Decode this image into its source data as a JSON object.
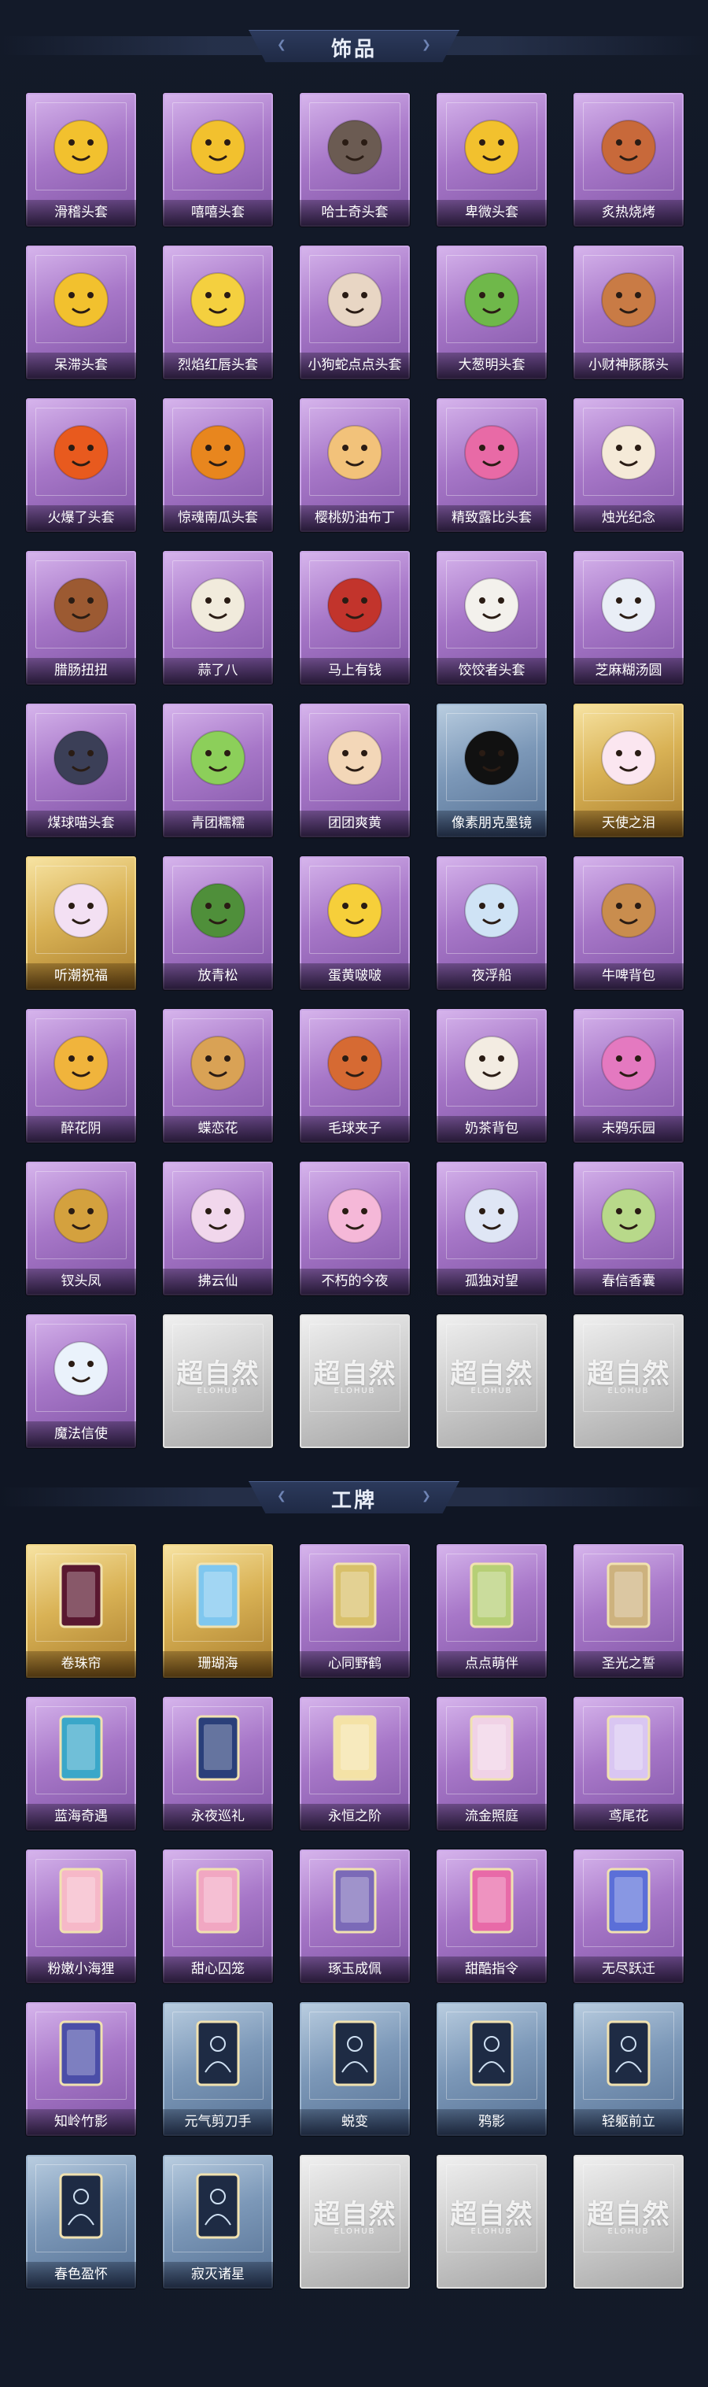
{
  "sections": [
    {
      "title": "饰品",
      "items": [
        {
          "name": "滑稽头套",
          "tier": "purple",
          "icon": "smirk-face-icon",
          "color": "#f2c12e"
        },
        {
          "name": "嘻嘻头套",
          "tier": "purple",
          "icon": "grin-face-icon",
          "color": "#f2c12e"
        },
        {
          "name": "哈士奇头套",
          "tier": "purple",
          "icon": "husky-head-icon",
          "color": "#6b5b52"
        },
        {
          "name": "卑微头套",
          "tier": "purple",
          "icon": "meek-face-icon",
          "color": "#f2c12e"
        },
        {
          "name": "炙热烧烤",
          "tier": "purple",
          "icon": "toast-head-icon",
          "color": "#c8693a"
        },
        {
          "name": "呆滞头套",
          "tier": "purple",
          "icon": "dazed-face-icon",
          "color": "#f2c12e"
        },
        {
          "name": "烈焰红唇头套",
          "tier": "purple",
          "icon": "pikachu-lips-icon",
          "color": "#f4d03f"
        },
        {
          "name": "小狗蛇点点头套",
          "tier": "purple",
          "icon": "puppy-snake-icon",
          "color": "#e8d6c4"
        },
        {
          "name": "大葱明头套",
          "tier": "purple",
          "icon": "scallion-head-icon",
          "color": "#6fb84a"
        },
        {
          "name": "小财神豚豚头",
          "tier": "purple",
          "icon": "fortune-pig-icon",
          "color": "#c97b45"
        },
        {
          "name": "火爆了头套",
          "tier": "purple",
          "icon": "flame-head-icon",
          "color": "#e85a1e"
        },
        {
          "name": "惊魂南瓜头套",
          "tier": "purple",
          "icon": "pumpkin-head-icon",
          "color": "#e8861e"
        },
        {
          "name": "樱桃奶油布丁",
          "tier": "purple",
          "icon": "pudding-head-icon",
          "color": "#f2c27a"
        },
        {
          "name": "精致露比头套",
          "tier": "purple",
          "icon": "pink-monster-icon",
          "color": "#e86aa6"
        },
        {
          "name": "烛光纪念",
          "tier": "purple",
          "icon": "candle-head-icon",
          "color": "#f5ead8"
        },
        {
          "name": "腊肠扭扭",
          "tier": "purple",
          "icon": "dachshund-icon",
          "color": "#9c5a32"
        },
        {
          "name": "蒜了八",
          "tier": "purple",
          "icon": "garlic-head-icon",
          "color": "#f1ebdc"
        },
        {
          "name": "马上有钱",
          "tier": "purple",
          "icon": "red-horse-icon",
          "color": "#c2342c"
        },
        {
          "name": "饺饺者头套",
          "tier": "purple",
          "icon": "dumpling-head-icon",
          "color": "#f3f1ec"
        },
        {
          "name": "芝麻糊汤圆",
          "tier": "purple",
          "icon": "tangyuan-icon",
          "color": "#e9eef6"
        },
        {
          "name": "煤球喵头套",
          "tier": "purple",
          "icon": "black-cat-icon",
          "color": "#3b3f57"
        },
        {
          "name": "青团糯糯",
          "tier": "purple",
          "icon": "qingtuan-icon",
          "color": "#8ccf5a"
        },
        {
          "name": "团团爽黄",
          "tier": "purple",
          "icon": "round-cat-icon",
          "color": "#f3d7b8"
        },
        {
          "name": "像素朋克墨镜",
          "tier": "blue",
          "icon": "pixel-sunglasses-icon",
          "color": "#111111"
        },
        {
          "name": "天使之泪",
          "tier": "gold",
          "icon": "angel-wings-icon",
          "color": "#fbe6f0"
        },
        {
          "name": "听潮祝福",
          "tier": "gold",
          "icon": "tide-blessing-icon",
          "color": "#f3e0f3"
        },
        {
          "name": "放青松",
          "tier": "purple",
          "icon": "bonsai-pine-icon",
          "color": "#4f8f3a"
        },
        {
          "name": "蛋黄啵啵",
          "tier": "purple",
          "icon": "yolk-chick-icon",
          "color": "#f6cf3a"
        },
        {
          "name": "夜浮船",
          "tier": "purple",
          "icon": "jellyfish-icon",
          "color": "#cfe3f5"
        },
        {
          "name": "牛啤背包",
          "tier": "purple",
          "icon": "cow-beer-icon",
          "color": "#c98d4e"
        },
        {
          "name": "醉花阴",
          "tier": "purple",
          "icon": "flower-headdress-icon",
          "color": "#f0b43c"
        },
        {
          "name": "蝶恋花",
          "tier": "purple",
          "icon": "butterfly-bell-icon",
          "color": "#d9a255"
        },
        {
          "name": "毛球夹子",
          "tier": "purple",
          "icon": "raccoon-clip-icon",
          "color": "#d66a33"
        },
        {
          "name": "奶茶背包",
          "tier": "purple",
          "icon": "milktea-bag-icon",
          "color": "#f3ece2"
        },
        {
          "name": "未鸦乐园",
          "tier": "purple",
          "icon": "jester-doll-icon",
          "color": "#e479c0"
        },
        {
          "name": "钗头凤",
          "tier": "purple",
          "icon": "phoenix-hairpin-icon",
          "color": "#d4a13e"
        },
        {
          "name": "拂云仙",
          "tier": "purple",
          "icon": "cloud-fairy-icon",
          "color": "#f1d7ec"
        },
        {
          "name": "不朽的今夜",
          "tier": "purple",
          "icon": "pink-fox-icon",
          "color": "#f5b8d8"
        },
        {
          "name": "孤独对望",
          "tier": "purple",
          "icon": "lonely-gaze-icon",
          "color": "#dfe6f5"
        },
        {
          "name": "春信香囊",
          "tier": "purple",
          "icon": "spring-sachet-icon",
          "color": "#b8d98a"
        },
        {
          "name": "魔法信使",
          "tier": "purple",
          "icon": "mouse-messenger-icon",
          "color": "#eaf2fb"
        },
        {
          "name": "",
          "tier": "silver",
          "icon": "locked-placeholder-icon",
          "color": "#ffffff",
          "watermark": "超自然",
          "watermark_sub": "ELOHUB"
        },
        {
          "name": "",
          "tier": "silver",
          "icon": "locked-placeholder-icon",
          "color": "#ffffff",
          "watermark": "超自然",
          "watermark_sub": "ELOHUB"
        },
        {
          "name": "",
          "tier": "silver",
          "icon": "locked-placeholder-icon",
          "color": "#ffffff",
          "watermark": "超自然",
          "watermark_sub": "ELOHUB"
        },
        {
          "name": "",
          "tier": "silver",
          "icon": "locked-placeholder-icon",
          "color": "#ffffff",
          "watermark": "超自然",
          "watermark_sub": "ELOHUB"
        }
      ]
    },
    {
      "title": "工牌",
      "items": [
        {
          "name": "卷珠帘",
          "tier": "gold",
          "icon": "crimson-card-icon",
          "color": "#5a1830"
        },
        {
          "name": "珊瑚海",
          "tier": "gold",
          "icon": "coral-sea-card-icon",
          "color": "#7fc7ef"
        },
        {
          "name": "心同野鹤",
          "tier": "purple",
          "icon": "crane-card-icon",
          "color": "#d8c06a"
        },
        {
          "name": "点点萌伴",
          "tier": "purple",
          "icon": "meadow-card-icon",
          "color": "#b6cf76"
        },
        {
          "name": "圣光之誓",
          "tier": "purple",
          "icon": "holy-light-card-icon",
          "color": "#cdb27e"
        },
        {
          "name": "蓝海奇遇",
          "tier": "purple",
          "icon": "blue-sea-card-icon",
          "color": "#3aa7c9"
        },
        {
          "name": "永夜巡礼",
          "tier": "purple",
          "icon": "night-card-icon",
          "color": "#2a3f7a"
        },
        {
          "name": "永恒之阶",
          "tier": "purple",
          "icon": "eternal-stairs-card-icon",
          "color": "#f4e2a6"
        },
        {
          "name": "流金照庭",
          "tier": "purple",
          "icon": "gilded-garden-card-icon",
          "color": "#f0d2e6"
        },
        {
          "name": "鸢尾花",
          "tier": "purple",
          "icon": "iris-card-icon",
          "color": "#d9c6f2"
        },
        {
          "name": "粉嫩小海狸",
          "tier": "purple",
          "icon": "beaver-card-icon",
          "color": "#f6b8c8"
        },
        {
          "name": "甜心囚笼",
          "tier": "purple",
          "icon": "sweet-cage-card-icon",
          "color": "#f1a7c2"
        },
        {
          "name": "琢玉成佩",
          "tier": "purple",
          "icon": "jade-pendant-card-icon",
          "color": "#7b6ab8"
        },
        {
          "name": "甜酷指令",
          "tier": "purple",
          "icon": "sweet-cool-card-icon",
          "color": "#e86aa8"
        },
        {
          "name": "无尽跃迁",
          "tier": "purple",
          "icon": "warp-card-icon",
          "color": "#5b6fd8"
        },
        {
          "name": "知岭竹影",
          "tier": "purple",
          "icon": "bamboo-shadow-card-icon",
          "color": "#4b4ea8"
        },
        {
          "name": "元气剪刀手",
          "tier": "blue",
          "icon": "silhouette-card-icon",
          "color": "#1e2b44"
        },
        {
          "name": "蜕变",
          "tier": "blue",
          "icon": "silhouette-card-icon",
          "color": "#1e2b44"
        },
        {
          "name": "鸦影",
          "tier": "blue",
          "icon": "silhouette-card-icon",
          "color": "#1e2b44"
        },
        {
          "name": "轻躯前立",
          "tier": "blue",
          "icon": "silhouette-card-icon",
          "color": "#1e2b44"
        },
        {
          "name": "春色盈怀",
          "tier": "blue",
          "icon": "silhouette-card-icon",
          "color": "#1e2b44"
        },
        {
          "name": "寂灭诸星",
          "tier": "blue",
          "icon": "silhouette-card-icon",
          "color": "#1e2b44"
        },
        {
          "name": "",
          "tier": "silver",
          "icon": "locked-placeholder-icon",
          "color": "#ffffff",
          "watermark": "超自然",
          "watermark_sub": "ELOHUB"
        },
        {
          "name": "",
          "tier": "silver",
          "icon": "locked-placeholder-icon",
          "color": "#ffffff",
          "watermark": "超自然",
          "watermark_sub": "ELOHUB"
        },
        {
          "name": "",
          "tier": "silver",
          "icon": "locked-placeholder-icon",
          "color": "#ffffff",
          "watermark": "超自然",
          "watermark_sub": "ELOHUB"
        }
      ]
    }
  ],
  "theme": {
    "background": "#101624",
    "purple": "#a777c8",
    "gold": "#d9b255",
    "blue": "#7c98b8",
    "silver": "#cfcfcf"
  }
}
